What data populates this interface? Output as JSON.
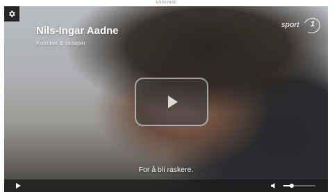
{
  "ad_label": "ANNONSE",
  "video": {
    "person_name": "Nils-Ingar Aadne",
    "person_role": "Komiker & skiløper",
    "subtitle": "For å bli raskere.",
    "logo": {
      "text": "sport",
      "number": "1"
    },
    "settings_icon": "gear-icon",
    "big_play_icon": "play-icon"
  },
  "controls": {
    "play_icon": "play-icon",
    "volume_icon": "speaker-icon",
    "volume_level": 0.25
  }
}
